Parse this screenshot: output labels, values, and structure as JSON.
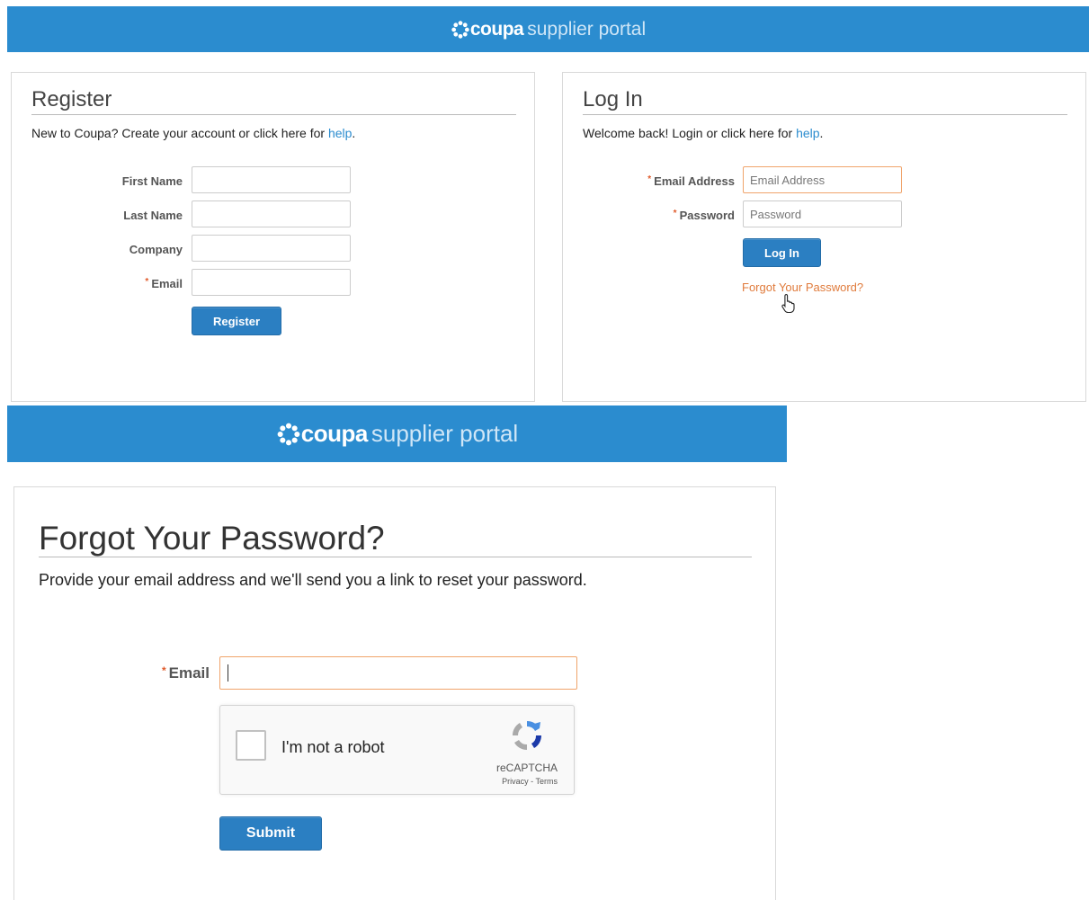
{
  "header": {
    "brand": "coupa",
    "subtitle": "supplier portal"
  },
  "register": {
    "title": "Register",
    "intro_text": "New to Coupa? Create your account or click here for ",
    "help_link": "help",
    "intro_end": ".",
    "fields": {
      "first_name": "First Name",
      "last_name": "Last Name",
      "company": "Company",
      "email": "Email"
    },
    "required_mark": "*",
    "button": "Register"
  },
  "login": {
    "title": "Log In",
    "intro_text": "Welcome back! Login or click here for ",
    "help_link": "help",
    "intro_end": ".",
    "email_label": "Email Address",
    "email_placeholder": "Email Address",
    "password_label": "Password",
    "password_placeholder": "Password",
    "required_mark": "*",
    "button": "Log In",
    "forgot_link": "Forgot Your Password?"
  },
  "forgot": {
    "title": "Forgot Your Password?",
    "intro": "Provide your email address and we'll send you a link to reset your password.",
    "email_label": "Email",
    "required_mark": "*",
    "recaptcha": {
      "label": "I'm not a robot",
      "brand": "reCAPTCHA",
      "terms": "Privacy - Terms"
    },
    "button": "Submit"
  },
  "colors": {
    "banner": "#2b8ccf",
    "button": "#2b7fc2",
    "link": "#2b8ccf",
    "forgot_link": "#e07b3c",
    "required": "#e05a2b",
    "focus_border": "#f0a46b"
  }
}
